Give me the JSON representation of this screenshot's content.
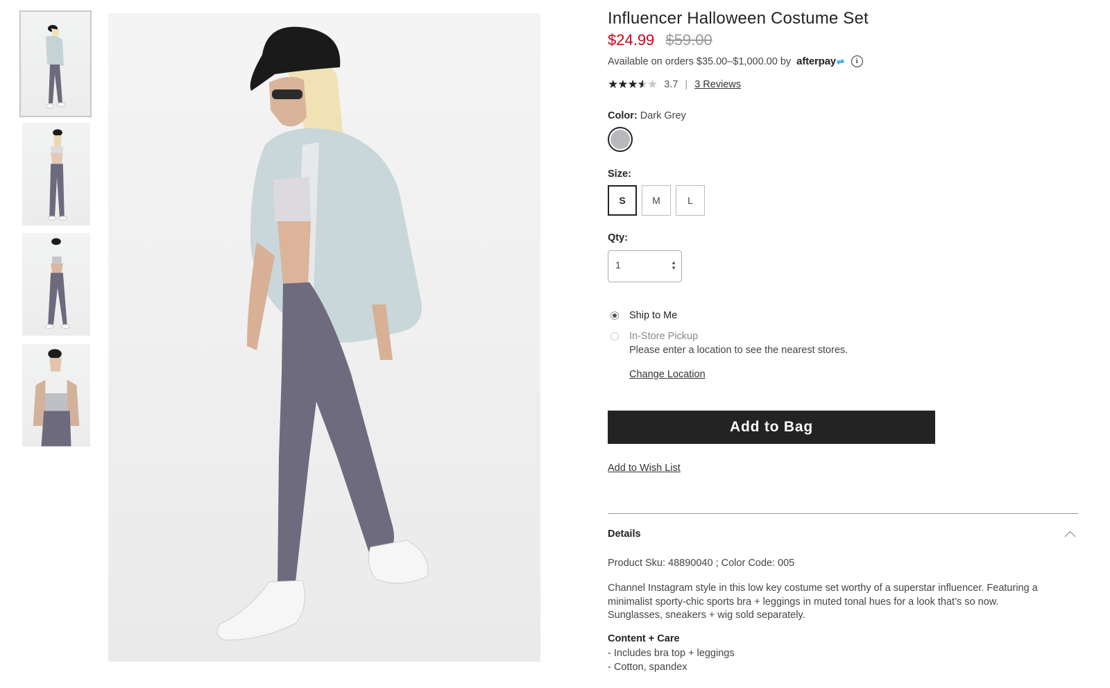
{
  "product": {
    "title": "Influencer Halloween Costume Set",
    "sale_price": "$24.99",
    "original_price": "$59.00",
    "afterpay_text": "Available on orders $35.00–$1,000.00 by",
    "afterpay_brand": "afterpay",
    "rating_score": "3.7",
    "rating_value": 3.7,
    "reviews_link": "3 Reviews"
  },
  "color": {
    "label": "Color:",
    "value": "Dark Grey",
    "swatch_hex": "#b9b9bd"
  },
  "size": {
    "label": "Size:",
    "options": [
      "S",
      "M",
      "L"
    ],
    "selected": "S"
  },
  "qty": {
    "label": "Qty:",
    "value": "1"
  },
  "fulfillment": {
    "ship_label": "Ship to Me",
    "pickup_label": "In-Store Pickup",
    "pickup_note": "Please enter a location to see the nearest stores.",
    "change_location": "Change Location"
  },
  "actions": {
    "add_to_bag": "Add to Bag",
    "add_to_wishlist": "Add to Wish List"
  },
  "details": {
    "heading": "Details",
    "sku_line": "Product Sku: 48890040 ; Color Code: 005",
    "description": "Channel Instagram style in this low key costume set worthy of a superstar influencer. Featuring a minimalist sporty-chic sports bra + leggings in muted tonal hues for a look that’s so now. Sunglasses, sneakers + wig sold separately.",
    "care_heading": "Content + Care",
    "care_items": [
      "- Includes bra top + leggings",
      "- Cotton, spandex"
    ]
  },
  "colors": {
    "sale": "#d0021b",
    "button_bg": "#232323",
    "afterpay_accent": "#1ea3d8"
  }
}
